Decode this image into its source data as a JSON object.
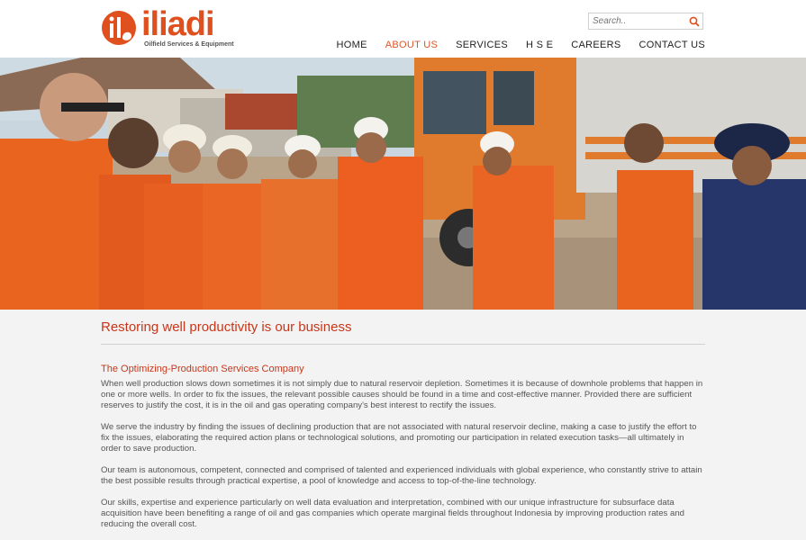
{
  "brand": {
    "name": "iliadi",
    "tagline": "Oilfield Services & Equipment",
    "color": "#e0501f"
  },
  "search": {
    "placeholder": "Search.."
  },
  "nav": [
    {
      "label": "HOME",
      "active": false
    },
    {
      "label": "ABOUT US",
      "active": true
    },
    {
      "label": "SERVICES",
      "active": false
    },
    {
      "label": "H S E",
      "active": false
    },
    {
      "label": "CAREERS",
      "active": false
    },
    {
      "label": "CONTACT US",
      "active": false
    }
  ],
  "hero": {
    "icon": "workers-photo"
  },
  "main": {
    "title": "Restoring well productivity is our business",
    "subtitle": "The Optimizing-Production Services Company",
    "paragraphs": [
      "When well production slows down sometimes it is not simply due to natural reservoir depletion. Sometimes it is because of downhole problems that happen in one or more wells. In order to fix the issues, the relevant possible causes should be found in a time and cost-effective manner. Provided there are sufficient reserves to justify the cost, it is in the oil and gas operating company's best interest to rectify the issues.",
      "We serve the industry by finding the issues of declining production that are not associated with natural reservoir decline, making a case to justify the effort to fix the issues, elaborating the required action plans or technological solutions, and promoting our participation in related execution tasks—all ultimately in order to save production.",
      "Our team is autonomous, competent, connected and comprised of talented and experienced individuals with global experience, who constantly strive to attain the best possible results through practical expertise, a pool of knowledge and access to top-of-the-line technology.",
      "Our skills, expertise and experience particularly on well data evaluation and interpretation, combined with our unique infrastructure for subsurface data acquisition have been benefiting a range of oil and gas companies which operate marginal fields throughout Indonesia by improving production rates and reducing the overall cost."
    ]
  },
  "colors": {
    "accent": "#c8371a",
    "nav_active": "#d9572a",
    "background": "#f3f3f3"
  }
}
